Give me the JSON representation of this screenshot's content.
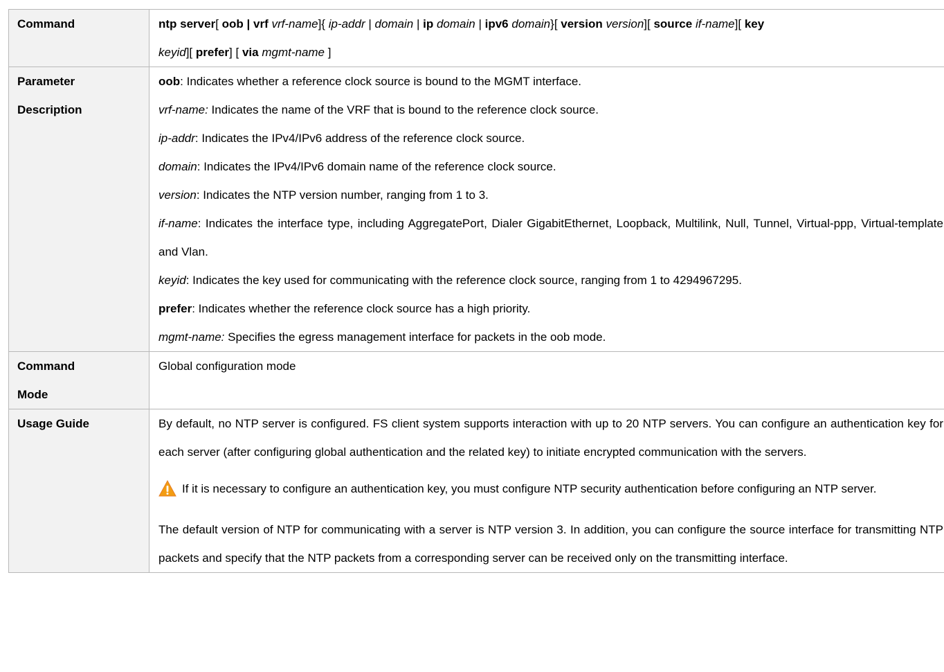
{
  "rows": {
    "command": {
      "label": "Command",
      "syntax_line1": {
        "ntp_server": "ntp server",
        "lb1": "[ ",
        "oob_vrf": "oob | vrf",
        "sp1": " ",
        "vrf_name": "vrf-name",
        "rb_lc": "]{ ",
        "ip_addr": "ip-addr",
        "sep1": " | ",
        "domain1": "domain",
        "sep2": " | ",
        "ip_kw": "ip",
        "sp2": " ",
        "domain2": "domain",
        "sep3": " | ",
        "ipv6_kw": "ipv6",
        "sp3": " ",
        "domain3": "domain",
        "rc_lb": "}[ ",
        "version_kw": "version",
        "sp4": " ",
        "version_arg": "version",
        "rb_lb1": "][ ",
        "source_kw": "source",
        "sp5": " ",
        "if_name": "if-name",
        "rb_lb2": "][ ",
        "key_kw": "key"
      },
      "syntax_line2": {
        "keyid": "keyid",
        "rb_lb3": "][ ",
        "prefer_kw": "prefer",
        "rb_lb4": "] [ ",
        "via_kw": "via",
        "sp6": " ",
        "mgmt_name": "mgmt-name",
        "rb_end": " ]"
      }
    },
    "parameter": {
      "label_line1": "Parameter",
      "label_line2": "Description",
      "items": [
        {
          "term": "oob",
          "desc": ": Indicates whether a reference clock source is bound to the MGMT interface."
        },
        {
          "term": "vrf-name:",
          "desc": " Indicates the name of the VRF that is bound to the reference clock source."
        },
        {
          "term": "ip-addr",
          "desc": ": Indicates the IPv4/IPv6 address of the reference clock source."
        },
        {
          "term": "domain",
          "desc": ": Indicates the IPv4/IPv6 domain name of the reference clock source."
        },
        {
          "term": "version",
          "desc": ": Indicates the NTP version number, ranging from 1 to 3."
        },
        {
          "term": "if-name",
          "desc": ": Indicates the interface type, including AggregatePort, Dialer GigabitEthernet, Loopback, Multilink, Null, Tunnel, Virtual-ppp, Virtual-template and Vlan."
        },
        {
          "term": "keyid",
          "desc": ": Indicates the key used for communicating with the reference clock source, ranging from 1 to 4294967295."
        },
        {
          "term": "prefer",
          "desc": ": Indicates whether the reference clock source has a high priority."
        },
        {
          "term": "mgmt-name:",
          "desc": " Specifies the egress management interface for packets in the oob mode."
        }
      ]
    },
    "mode": {
      "label_line1": "Command",
      "label_line2": "Mode",
      "value": "Global configuration mode"
    },
    "usage": {
      "label": "Usage Guide",
      "para1": "By default, no NTP server is configured. FS client system supports interaction with up to 20 NTP servers. You can configure an authentication key for each server (after configuring global authentication and the related key) to initiate encrypted communication with the servers.",
      "caution": "If it is necessary to configure an authentication key, you must configure NTP security authentication before configuring an NTP server.",
      "caution_icon": "warning-triangle-icon",
      "caution_icon_color": "#f39c12",
      "para3": "The default version of NTP for communicating with a server is NTP version 3. In addition, you can configure the source interface for transmitting NTP packets and specify that the NTP packets from a corresponding server can be received only on the transmitting interface."
    }
  }
}
